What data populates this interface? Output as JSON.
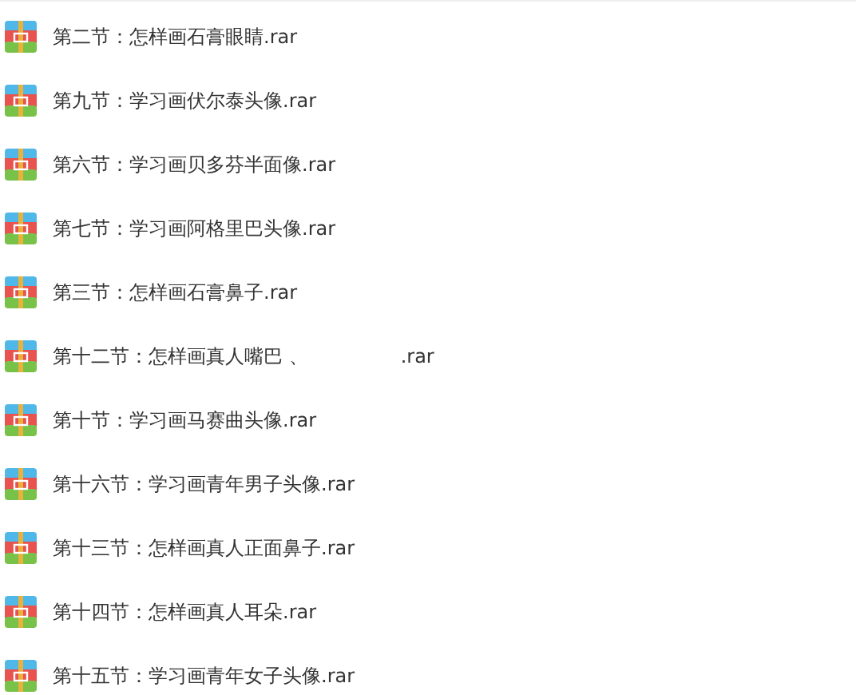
{
  "files": [
    {
      "name_parts": [
        "第二节：怎样画石膏眼睛.rar"
      ]
    },
    {
      "name_parts": [
        "第九节：学习画伏尔泰头像.rar"
      ]
    },
    {
      "name_parts": [
        "第六节：学习画贝多芬半面像.rar"
      ]
    },
    {
      "name_parts": [
        "第七节：学习画阿格里巴头像.rar"
      ]
    },
    {
      "name_parts": [
        "第三节：怎样画石膏鼻子.rar"
      ]
    },
    {
      "name_parts": [
        "第十二节：怎样画真人嘴巴 、",
        ".rar"
      ]
    },
    {
      "name_parts": [
        "第十节：学习画马赛曲头像.rar"
      ]
    },
    {
      "name_parts": [
        "第十六节：学习画青年男子头像.rar"
      ]
    },
    {
      "name_parts": [
        "第十三节：怎样画真人正面鼻子.rar"
      ]
    },
    {
      "name_parts": [
        "第十四节：怎样画真人耳朵.rar"
      ]
    },
    {
      "name_parts": [
        "第十五节：学习画青年女子头像.rar"
      ]
    }
  ]
}
